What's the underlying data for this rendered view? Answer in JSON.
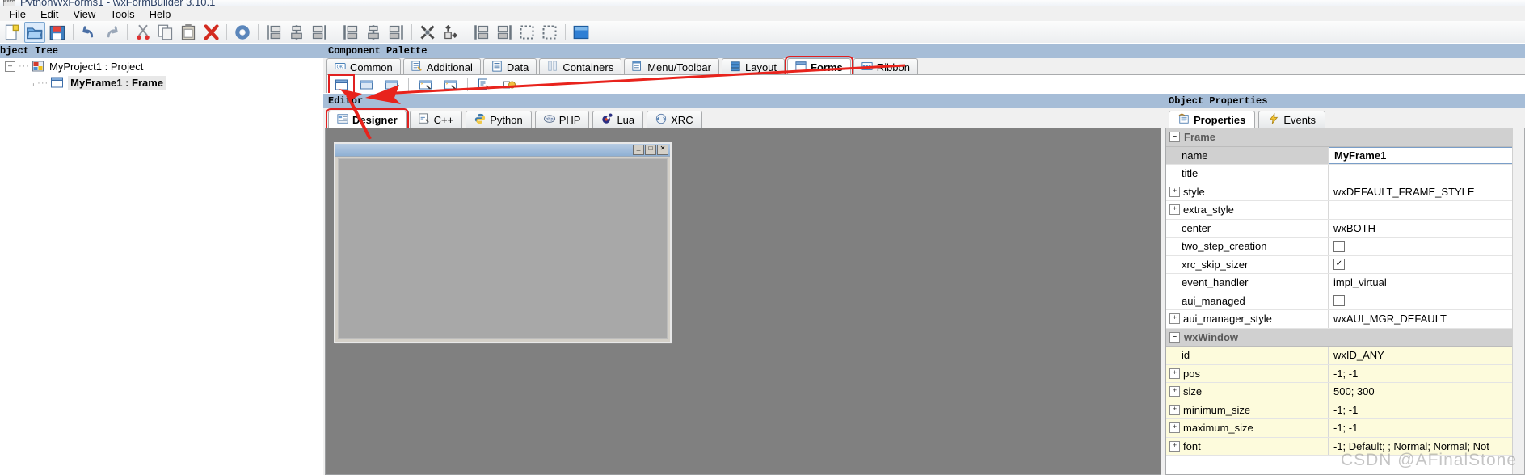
{
  "window": {
    "title": "PythonWxForms1 - wxFormBuilder 3.10.1",
    "icon": "wxfb-icon"
  },
  "menu": {
    "items": [
      {
        "label": "File"
      },
      {
        "label": "Edit"
      },
      {
        "label": "View"
      },
      {
        "label": "Tools"
      },
      {
        "label": "Help"
      }
    ]
  },
  "toolbar": {
    "buttons": [
      {
        "name": "new-project-icon",
        "tip": "New"
      },
      {
        "name": "open-project-icon",
        "tip": "Open"
      },
      {
        "name": "save-project-icon",
        "tip": "Save"
      },
      {
        "name": "undo-icon",
        "tip": "Undo"
      },
      {
        "name": "redo-icon",
        "tip": "Redo"
      },
      {
        "name": "cut-icon",
        "tip": "Cut"
      },
      {
        "name": "copy-icon",
        "tip": "Copy"
      },
      {
        "name": "paste-icon",
        "tip": "Paste"
      },
      {
        "name": "delete-icon",
        "tip": "Delete"
      },
      {
        "name": "generate-code-icon",
        "tip": "Generate Code"
      },
      {
        "name": "align-left-icon",
        "tip": "Align Left"
      },
      {
        "name": "align-center-horizontal-icon",
        "tip": "Align Center"
      },
      {
        "name": "align-right-icon",
        "tip": "Align Right"
      },
      {
        "name": "align-top-icon",
        "tip": "Align Top"
      },
      {
        "name": "align-center-vertical-icon",
        "tip": "Align Middle"
      },
      {
        "name": "align-bottom-icon",
        "tip": "Align Bottom"
      },
      {
        "name": "expand-icon",
        "tip": "Expand"
      },
      {
        "name": "stretch-icon",
        "tip": "Stretch"
      },
      {
        "name": "border-left-icon",
        "tip": "Border Left"
      },
      {
        "name": "border-right-icon",
        "tip": "Border Right"
      },
      {
        "name": "border-top-icon",
        "tip": "Border Top"
      },
      {
        "name": "border-bottom-icon",
        "tip": "Border Bottom"
      },
      {
        "name": "xrc-preview-icon",
        "tip": "XRC Preview"
      }
    ]
  },
  "object_tree": {
    "header": "bject Tree",
    "nodes": [
      {
        "label": "MyProject1 : Project",
        "icon": "project-icon",
        "level": 1,
        "expanded": true,
        "selected": false
      },
      {
        "label": "MyFrame1 : Frame",
        "icon": "frame-icon",
        "level": 2,
        "expanded": false,
        "selected": true
      }
    ]
  },
  "component_palette": {
    "header": "Component Palette",
    "tabs": [
      {
        "label": "Common",
        "icon": "common-icon",
        "active": false,
        "highlighted": false
      },
      {
        "label": "Additional",
        "icon": "additional-icon",
        "active": false,
        "highlighted": false
      },
      {
        "label": "Data",
        "icon": "data-icon",
        "active": false,
        "highlighted": false
      },
      {
        "label": "Containers",
        "icon": "containers-icon",
        "active": false,
        "highlighted": false
      },
      {
        "label": "Menu/Toolbar",
        "icon": "menu-toolbar-icon",
        "active": false,
        "highlighted": false
      },
      {
        "label": "Layout",
        "icon": "layout-icon",
        "active": false,
        "highlighted": false
      },
      {
        "label": "Forms",
        "icon": "forms-icon",
        "active": true,
        "highlighted": true
      },
      {
        "label": "Ribbon",
        "icon": "ribbon-icon",
        "active": false,
        "highlighted": false
      }
    ],
    "items": [
      {
        "name": "frame-component-icon",
        "highlighted": true
      },
      {
        "name": "panel-component-icon",
        "highlighted": false
      },
      {
        "name": "dialog-component-icon",
        "highlighted": false
      },
      {
        "name": "wizard-component-icon",
        "highlighted": false
      },
      {
        "name": "wizard-page-component-icon",
        "highlighted": false
      },
      {
        "name": "popup-transient-window-icon",
        "highlighted": false
      },
      {
        "name": "image-list-icon",
        "highlighted": false
      }
    ]
  },
  "editor": {
    "header": "Editor",
    "tabs": [
      {
        "label": "Designer",
        "icon": "designer-icon",
        "active": true,
        "highlighted": true
      },
      {
        "label": "C++",
        "icon": "cpp-icon",
        "active": false,
        "highlighted": false
      },
      {
        "label": "Python",
        "icon": "python-icon",
        "active": false,
        "highlighted": false
      },
      {
        "label": "PHP",
        "icon": "php-icon",
        "active": false,
        "highlighted": false
      },
      {
        "label": "Lua",
        "icon": "lua-icon",
        "active": false,
        "highlighted": false
      },
      {
        "label": "XRC",
        "icon": "xrc-icon",
        "active": false,
        "highlighted": false
      }
    ],
    "preview_frame": {
      "title": "",
      "minimize_glyph": "_",
      "maximize_glyph": "□",
      "close_glyph": "✕"
    }
  },
  "object_properties": {
    "header": "Object Properties",
    "tabs": [
      {
        "label": "Properties",
        "icon": "properties-icon",
        "active": true
      },
      {
        "label": "Events",
        "icon": "events-icon",
        "active": false
      }
    ],
    "groups": [
      {
        "title": "Frame",
        "expanded": true,
        "yellow": false,
        "rows": [
          {
            "name": "name",
            "value": "MyFrame1",
            "expandable": false,
            "type": "text",
            "selected": true
          },
          {
            "name": "title",
            "value": "",
            "expandable": false,
            "type": "text",
            "selected": false
          },
          {
            "name": "style",
            "value": "wxDEFAULT_FRAME_STYLE",
            "expandable": true,
            "type": "text",
            "selected": false
          },
          {
            "name": "extra_style",
            "value": "",
            "expandable": true,
            "type": "text",
            "selected": false
          },
          {
            "name": "center",
            "value": "wxBOTH",
            "expandable": false,
            "type": "text",
            "selected": false
          },
          {
            "name": "two_step_creation",
            "value": "",
            "expandable": false,
            "type": "checkbox",
            "checked": false,
            "selected": false
          },
          {
            "name": "xrc_skip_sizer",
            "value": "",
            "expandable": false,
            "type": "checkbox",
            "checked": true,
            "selected": false
          },
          {
            "name": "event_handler",
            "value": "impl_virtual",
            "expandable": false,
            "type": "text",
            "selected": false
          },
          {
            "name": "aui_managed",
            "value": "",
            "expandable": false,
            "type": "checkbox",
            "checked": false,
            "selected": false
          },
          {
            "name": "aui_manager_style",
            "value": "wxAUI_MGR_DEFAULT",
            "expandable": true,
            "type": "text",
            "selected": false
          }
        ]
      },
      {
        "title": "wxWindow",
        "expanded": true,
        "yellow": true,
        "rows": [
          {
            "name": "id",
            "value": "wxID_ANY",
            "expandable": false,
            "type": "text",
            "selected": false
          },
          {
            "name": "pos",
            "value": "-1; -1",
            "expandable": true,
            "type": "text",
            "selected": false
          },
          {
            "name": "size",
            "value": "500; 300",
            "expandable": true,
            "type": "text",
            "selected": false
          },
          {
            "name": "minimum_size",
            "value": "-1; -1",
            "expandable": true,
            "type": "text",
            "selected": false
          },
          {
            "name": "maximum_size",
            "value": "-1; -1",
            "expandable": true,
            "type": "text",
            "selected": false
          },
          {
            "name": "font",
            "value": "-1; Default; ; Normal; Normal; Not",
            "expandable": true,
            "type": "text",
            "selected": false
          }
        ]
      }
    ]
  },
  "watermark": "CSDN @AFinalStone",
  "colors": {
    "pane_header": "#a6bdd7",
    "annotation_red": "#e02020",
    "canvas_gray": "#808080",
    "yellow_row": "#fdfbdc"
  }
}
